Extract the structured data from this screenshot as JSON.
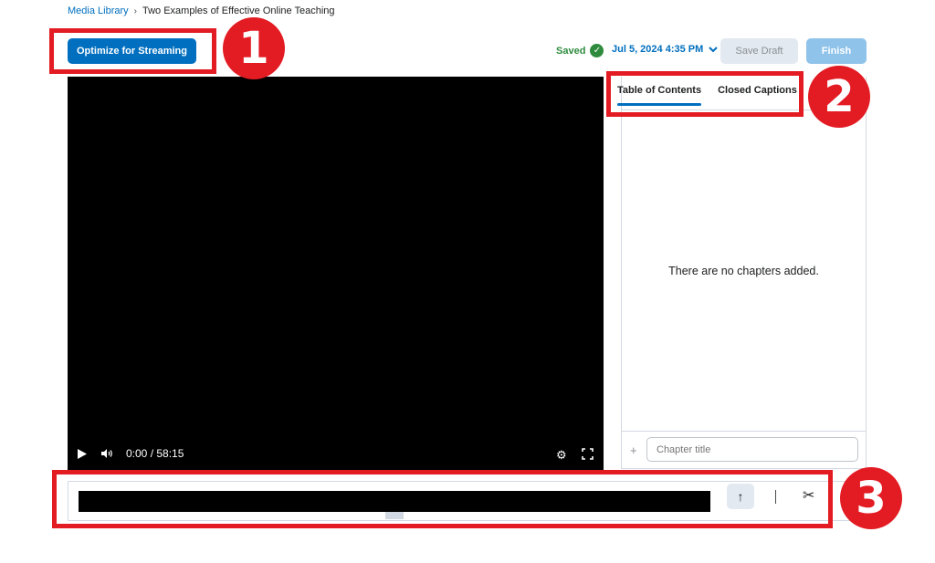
{
  "breadcrumb": {
    "root": "Media Library",
    "separator": "›",
    "current": "Two Examples of Effective Online Teaching"
  },
  "toolbar": {
    "optimize_label": "Optimize for Streaming",
    "saved_label": "Saved",
    "date_label": "Jul 5, 2024 4:35 PM",
    "save_draft_label": "Save Draft",
    "finish_label": "Finish"
  },
  "player": {
    "time": "0:00 / 58:15"
  },
  "panel": {
    "tabs": [
      {
        "label": "Table of Contents"
      },
      {
        "label": "Closed Captions"
      }
    ],
    "empty_message": "There are no chapters added.",
    "chapter_placeholder": "Chapter title"
  },
  "annotations": {
    "badge1": "1",
    "badge2": "2",
    "badge3": "3"
  },
  "colors": {
    "primary": "#006fbf",
    "annotation_red": "#e31b23",
    "saved_green": "#2e8b3d"
  }
}
